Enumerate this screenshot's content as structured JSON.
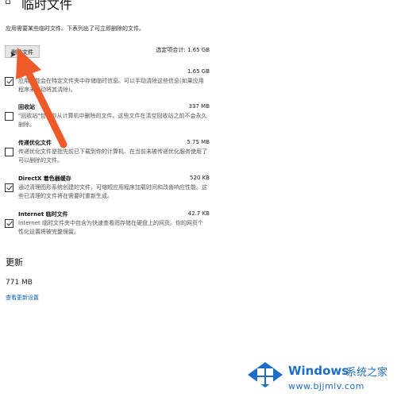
{
  "header": {
    "title": "临时文件",
    "icon": "home-icon"
  },
  "description": "应用需要某些临时文件。下表列出了可立即删除的文件。",
  "toolbar": {
    "delete_label": "删除文件",
    "selected_total": "选定项合计: 1.65 GB"
  },
  "items": [
    {
      "name": "临时",
      "size": "1.65 GB",
      "checked": true,
      "desc": "应用可能会在特定文件夹中存储临时信息。可以手动清除这些信息(如果应用程序未自动将其清除)。"
    },
    {
      "name": "回收站",
      "size": "337 MB",
      "checked": false,
      "desc": "\"回收站\"包含你从计算机中删除的文件。这些文件在清空回收站之前不会永久删除。"
    },
    {
      "name": "传递优化文件",
      "size": "5.75 MB",
      "checked": false,
      "desc": "传递优化文件是指先前已下载到你的计算机、在当前未被传递优化服务使用了可以删除的文件。"
    },
    {
      "name": "DirectX 着色器缓存",
      "size": "520 KB",
      "checked": true,
      "desc": "通过清理图形系统创建的文件，可缩短应用程序加载时间和改善响应性能。这些已清理的文件将在需要时重新生成。"
    },
    {
      "name": "Internet 临时文件",
      "size": "42.7 KB",
      "checked": true,
      "desc": "Internet 临时文件夹中包含为快速查看而存储在硬盘上的网页。你的网页个性化设置将被完整保留。"
    }
  ],
  "updates": {
    "heading": "更新",
    "size": "771 MB",
    "link": "查看更新设置"
  },
  "watermark": {
    "brand": "Windows",
    "suffix": "系统之家",
    "url": "www.bjjmlv.com"
  },
  "colors": {
    "arrow": "#ee5a2a",
    "link": "#0a5fb0",
    "brand": "#1b6fc6"
  }
}
